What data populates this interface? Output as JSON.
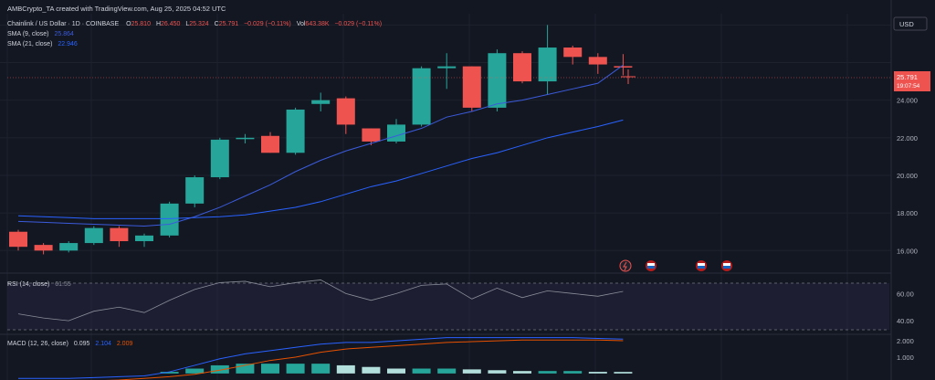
{
  "header": {
    "credit": "AMBCrypto_TA created with TradingView.com, Aug 25, 2025 04:52 UTC"
  },
  "legend": {
    "symbol": "Chainlink / US Dollar · 1D · COINBASE",
    "open_label": "O",
    "open": "25.810",
    "high_label": "H",
    "high": "26.450",
    "low_label": "L",
    "low": "25.324",
    "close_label": "C",
    "close": "25.791",
    "change": "−0.029 (−0.11%)",
    "vol_label": "Vol",
    "vol": "643.38K",
    "vol_change": "−0.029 (−0.11%)",
    "sma9_label": "SMA (9, close)",
    "sma9_value": "25.864",
    "sma21_label": "SMA (21, close)",
    "sma21_value": "22.946"
  },
  "currency": "USD",
  "price_tag": {
    "price": "25.791",
    "countdown": "19:07:54"
  },
  "rsi": {
    "label": "RSI (14, close)",
    "value": "61.55"
  },
  "macd": {
    "label": "MACD (12, 26, close)",
    "hist": "0.095",
    "macd": "2.104",
    "signal": "2.009"
  },
  "colors": {
    "background": "#131722",
    "up": "#26a69a",
    "down": "#ef5350",
    "sma9": "#3b5bdb",
    "sma21": "#2962ff",
    "rsi_line": "#8a8e99",
    "macd_line": "#2962ff",
    "signal_line": "#e65100",
    "hist_up": "#26a69a",
    "hist_light": "#b2dfdb"
  },
  "chart_data": [
    {
      "type": "candlestick",
      "ylim": [
        14.8,
        28.6
      ],
      "yticks": [
        16,
        18,
        20,
        22,
        24,
        26,
        28
      ],
      "ytick_labels": [
        "16.000",
        "18.000",
        "20.000",
        "22.000",
        "24.000",
        "",
        "28.000"
      ],
      "candles": [
        {
          "o": 17.0,
          "h": 17.1,
          "l": 16.0,
          "c": 16.2
        },
        {
          "o": 16.3,
          "h": 16.4,
          "l": 15.8,
          "c": 16.0
        },
        {
          "o": 16.0,
          "h": 16.5,
          "l": 15.9,
          "c": 16.4
        },
        {
          "o": 16.4,
          "h": 17.3,
          "l": 16.3,
          "c": 17.2
        },
        {
          "o": 17.2,
          "h": 17.3,
          "l": 16.2,
          "c": 16.5
        },
        {
          "o": 16.5,
          "h": 16.9,
          "l": 16.2,
          "c": 16.8
        },
        {
          "o": 16.8,
          "h": 18.6,
          "l": 16.7,
          "c": 18.5
        },
        {
          "o": 18.5,
          "h": 20.0,
          "l": 18.3,
          "c": 19.9
        },
        {
          "o": 19.9,
          "h": 22.0,
          "l": 19.8,
          "c": 21.9
        },
        {
          "o": 22.0,
          "h": 22.2,
          "l": 21.7,
          "c": 22.0
        },
        {
          "o": 22.1,
          "h": 22.3,
          "l": 21.2,
          "c": 21.2
        },
        {
          "o": 21.2,
          "h": 23.6,
          "l": 21.1,
          "c": 23.5
        },
        {
          "o": 23.8,
          "h": 24.4,
          "l": 23.4,
          "c": 24.0
        },
        {
          "o": 24.1,
          "h": 24.2,
          "l": 22.2,
          "c": 22.7
        },
        {
          "o": 22.5,
          "h": 22.5,
          "l": 21.6,
          "c": 21.8
        },
        {
          "o": 21.8,
          "h": 23.0,
          "l": 21.7,
          "c": 22.7
        },
        {
          "o": 22.7,
          "h": 25.8,
          "l": 22.6,
          "c": 25.7
        },
        {
          "o": 25.7,
          "h": 26.5,
          "l": 24.6,
          "c": 25.8
        },
        {
          "o": 25.8,
          "h": 25.8,
          "l": 23.4,
          "c": 23.6
        },
        {
          "o": 23.6,
          "h": 26.7,
          "l": 23.4,
          "c": 26.5
        },
        {
          "o": 26.5,
          "h": 26.6,
          "l": 24.9,
          "c": 25.0
        },
        {
          "o": 25.0,
          "h": 28.0,
          "l": 24.3,
          "c": 26.8
        },
        {
          "o": 26.8,
          "h": 26.9,
          "l": 25.9,
          "c": 26.3
        },
        {
          "o": 26.3,
          "h": 26.5,
          "l": 25.4,
          "c": 25.9
        },
        {
          "o": 25.81,
          "h": 26.45,
          "l": 25.324,
          "c": 25.791
        }
      ],
      "sma9": [
        17.55,
        17.5,
        17.45,
        17.4,
        17.35,
        17.3,
        17.4,
        17.8,
        18.3,
        18.9,
        19.5,
        20.2,
        20.8,
        21.3,
        21.7,
        22.1,
        22.5,
        23.1,
        23.4,
        23.8,
        24.0,
        24.3,
        24.6,
        24.9,
        25.864
      ],
      "sma21": [
        17.85,
        17.8,
        17.75,
        17.7,
        17.7,
        17.7,
        17.7,
        17.75,
        17.8,
        17.9,
        18.1,
        18.3,
        18.6,
        19.0,
        19.4,
        19.7,
        20.1,
        20.5,
        20.9,
        21.2,
        21.6,
        22.0,
        22.3,
        22.6,
        22.946
      ]
    },
    {
      "type": "line",
      "name": "RSI (14, close)",
      "ylim": [
        30,
        75
      ],
      "yticks": [
        40,
        60
      ],
      "ytick_labels": [
        "40.00",
        "60.00"
      ],
      "bands": [
        40,
        70
      ],
      "values": [
        45,
        42,
        40,
        47,
        50,
        46,
        55,
        63,
        68,
        69,
        65,
        68,
        70,
        60,
        55,
        60,
        66,
        67,
        56,
        64,
        57,
        62,
        60,
        58,
        61.55
      ]
    },
    {
      "type": "bar",
      "name": "MACD (12, 26, close)",
      "ylim": [
        -0.4,
        2.4
      ],
      "yticks": [
        1,
        2
      ],
      "ytick_labels": [
        "1.000",
        "2.000"
      ],
      "macd": [
        -0.3,
        -0.3,
        -0.3,
        -0.25,
        -0.2,
        -0.15,
        0.1,
        0.5,
        0.9,
        1.2,
        1.4,
        1.6,
        1.8,
        1.9,
        1.9,
        2.0,
        2.1,
        2.2,
        2.2,
        2.2,
        2.2,
        2.2,
        2.2,
        2.15,
        2.104
      ],
      "signal": [
        -0.5,
        -0.5,
        -0.5,
        -0.45,
        -0.4,
        -0.3,
        -0.2,
        -0.05,
        0.2,
        0.5,
        0.8,
        1.0,
        1.3,
        1.5,
        1.6,
        1.7,
        1.8,
        1.9,
        1.95,
        2.0,
        2.05,
        2.05,
        2.05,
        2.05,
        2.009
      ],
      "hist": [
        0,
        0,
        0,
        0,
        0,
        0,
        0.1,
        0.3,
        0.5,
        0.6,
        0.6,
        0.6,
        0.6,
        0.5,
        0.4,
        0.3,
        0.3,
        0.3,
        0.25,
        0.2,
        0.15,
        0.15,
        0.15,
        0.1,
        0.095
      ]
    }
  ]
}
